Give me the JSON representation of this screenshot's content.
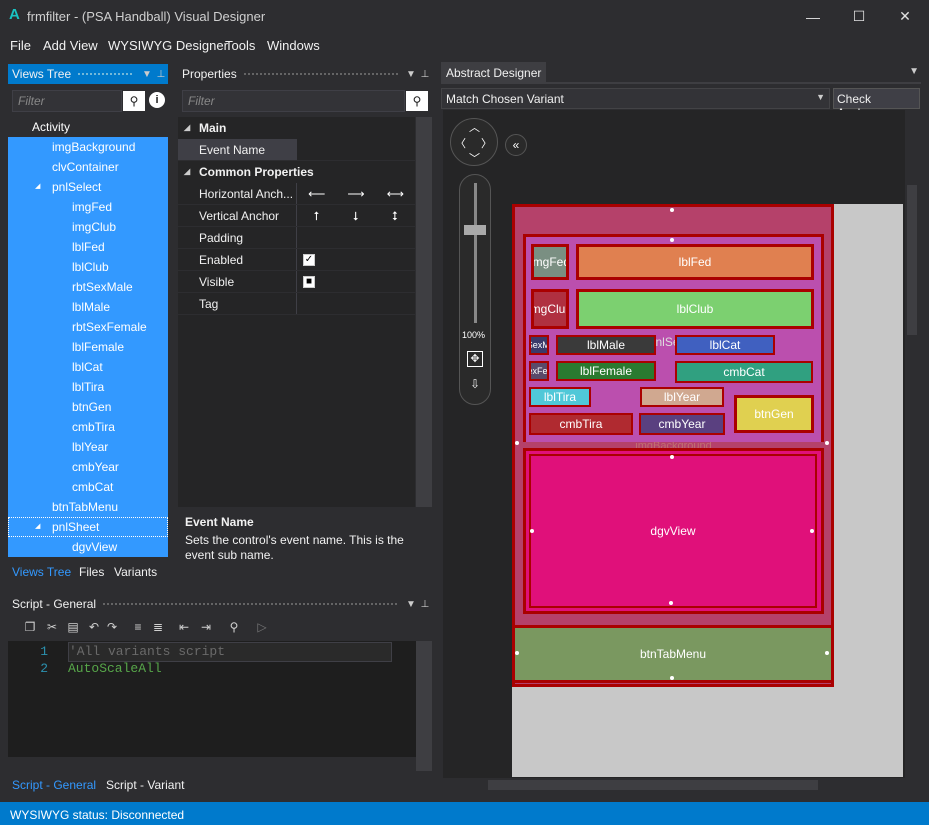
{
  "window": {
    "app_icon": "A",
    "title": "frmfilter - (PSA Handball) Visual Designer",
    "min": "—",
    "max": "☐",
    "close": "✕"
  },
  "menu": {
    "file": "File",
    "add_view": "Add View",
    "wysiwyg": "WYSIWYG Designer",
    "tools": "Tools",
    "windows": "Windows"
  },
  "views_tree": {
    "title": "Views Tree",
    "filter_placeholder": "Filter",
    "items": [
      {
        "label": "Activity"
      },
      {
        "label": "imgBackground"
      },
      {
        "label": "clvContainer"
      },
      {
        "label": "pnlSelect"
      },
      {
        "label": "imgFed"
      },
      {
        "label": "imgClub"
      },
      {
        "label": "lblFed"
      },
      {
        "label": "lblClub"
      },
      {
        "label": "rbtSexMale"
      },
      {
        "label": "lblMale"
      },
      {
        "label": "rbtSexFemale"
      },
      {
        "label": "lblFemale"
      },
      {
        "label": "lblCat"
      },
      {
        "label": "lblTira"
      },
      {
        "label": "btnGen"
      },
      {
        "label": "cmbTira"
      },
      {
        "label": "lblYear"
      },
      {
        "label": "cmbYear"
      },
      {
        "label": "cmbCat"
      },
      {
        "label": "btnTabMenu"
      },
      {
        "label": "pnlSheet"
      },
      {
        "label": "dgvView"
      }
    ],
    "tabs": {
      "views_tree": "Views Tree",
      "files": "Files",
      "variants": "Variants"
    }
  },
  "properties": {
    "title": "Properties",
    "filter_placeholder": "Filter",
    "cat_main": "Main",
    "event_name": "Event Name",
    "cat_common": "Common Properties",
    "horizontal_anchor": "Horizontal Anch...",
    "vertical_anchor": "Vertical Anchor",
    "padding": "Padding",
    "enabled": "Enabled",
    "visible": "Visible",
    "tag": "Tag",
    "h_arrows": [
      "⟵",
      "⟶",
      "⟷"
    ],
    "v_arrows": [
      "⭡",
      "⭣",
      "⭥"
    ],
    "enabled_check": "✓",
    "visible_check": "■",
    "desc_title": "Event Name",
    "desc_text": "Sets the control's event name. This is the event sub name."
  },
  "script": {
    "title": "Script - General",
    "lines": [
      {
        "num": "1",
        "text": "'All variants script"
      },
      {
        "num": "2",
        "text": "AutoScaleAll"
      }
    ],
    "comment_color": "#6a6a6a",
    "code_color": "#57a64a",
    "tabs": {
      "general": "Script - General",
      "variant": "Script - Variant"
    }
  },
  "designer": {
    "title": "Abstract Designer",
    "variant_select": "Match Chosen Variant",
    "check_anchors": "Check Anchors",
    "zoom": "100%",
    "controls": {
      "imgFed": "imgFed",
      "lblFed": "lblFed",
      "imgClub": "imgClub",
      "lblClub": "lblClub",
      "pnlSelect": "pnlSelect",
      "rbtMale": "rbtSexMale",
      "lblMale": "lblMale",
      "lblCat": "lblCat",
      "rbtFemale": "rbtSexFemale",
      "lblFemale": "lblFemale",
      "cmbCat": "cmbCat",
      "lblTira": "lblTira",
      "lblYear": "lblYear",
      "btnGen": "btnGen",
      "cmbTira": "cmbTira",
      "cmbYear": "cmbYear",
      "imgBackground": "imgBackground",
      "dgvView": "dgvView",
      "btnTabMenu": "btnTabMenu"
    }
  },
  "status": {
    "text": "WYSIWYG status: Disconnected"
  }
}
